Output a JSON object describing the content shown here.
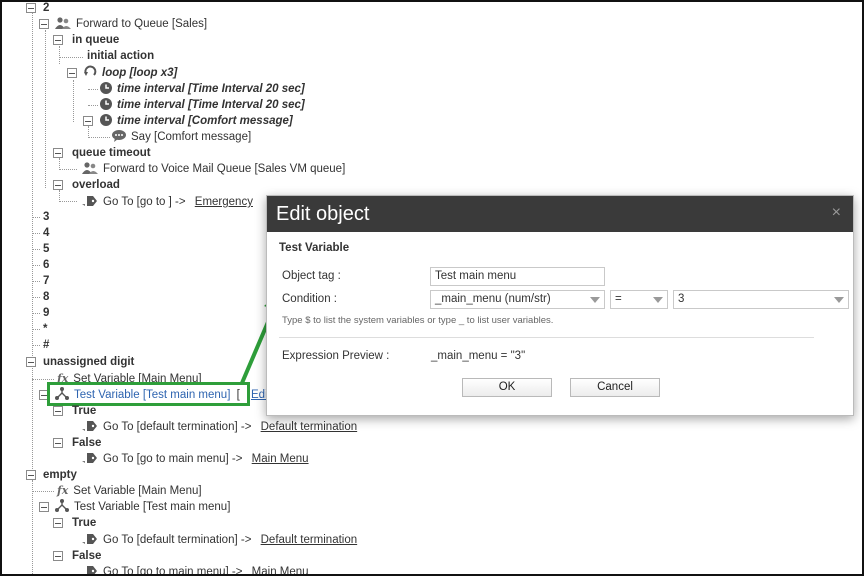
{
  "tree": {
    "n2": "2",
    "forward_queue": "Forward to Queue [Sales]",
    "in_queue": "in queue",
    "initial_action": "initial action",
    "loop": "loop [loop x3]",
    "time1": "time interval [Time Interval 20 sec]",
    "time2": "time interval [Time Interval 20 sec]",
    "time3": "time interval [Comfort message]",
    "say": "Say [Comfort message]",
    "queue_timeout": "queue timeout",
    "forward_vm": "Forward to Voice Mail Queue [Sales VM queue]",
    "overload": "overload",
    "goto_overload": "Go To [go to ] ->",
    "goto_overload_link": "Emergency",
    "digits": [
      "3",
      "4",
      "5",
      "6",
      "7",
      "8",
      "9",
      "*",
      "#"
    ],
    "unassigned_digit": "unassigned digit",
    "setvar1": "Set Variable [Main Menu]",
    "testvar1": "Test Variable [Test main menu]",
    "testvar1_tail": "[",
    "testvar1_edit": "Edi",
    "true1": "True",
    "goto_true1": "Go To [default termination] ->",
    "goto_true1_link": "Default termination",
    "false1": "False",
    "goto_false1": "Go To [go to main menu] ->",
    "goto_false1_link": "Main Menu",
    "empty": "empty",
    "setvar2": "Set Variable [Main Menu]",
    "testvar2": "Test Variable [Test main menu]",
    "true2": "True",
    "goto_true2": "Go To [default termination] ->",
    "goto_true2_link": "Default termination",
    "false2": "False",
    "goto_false2": "Go To [go to main menu] ->",
    "goto_false2_link": "Main Menu"
  },
  "dialog": {
    "title": "Edit object",
    "close": "×",
    "subtitle": "Test Variable",
    "object_tag_label": "Object tag :",
    "object_tag_value": "Test main menu",
    "condition_label": "Condition :",
    "condition_var": "_main_menu (num/str)",
    "condition_op": "=",
    "condition_value": "3",
    "hint": "Type $ to list the system variables or type _ to list user variables.",
    "preview_label": "Expression Preview :",
    "preview_value": "_main_menu = \"3\"",
    "ok": "OK",
    "cancel": "Cancel"
  },
  "colors": {
    "highlight": "#2e9e3a",
    "dialog_header": "#3a3a3a",
    "selected_text": "#2e64b0"
  },
  "icons": {
    "queue": "people-icon",
    "loop": "loop-icon",
    "time": "clock-icon",
    "say": "speech-bubble-icon",
    "goto": "tag-arrow-icon",
    "setvar": "fx-icon",
    "testvar": "branch-icon"
  }
}
